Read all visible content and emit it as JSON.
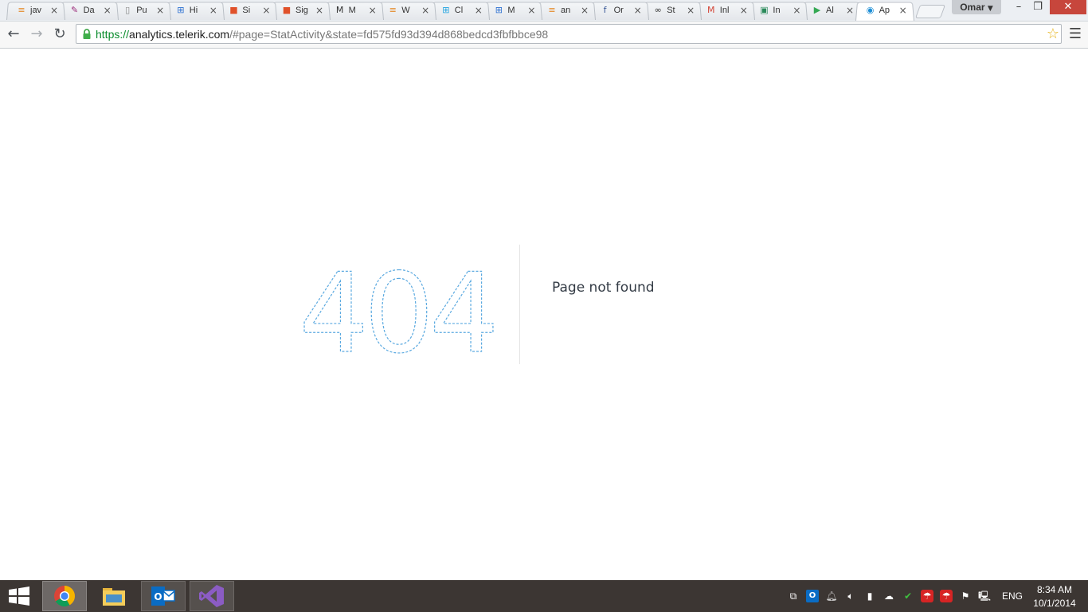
{
  "browser": {
    "tabs": [
      {
        "title": "jav",
        "icon": "stackoverflow-icon",
        "icon_glyph": "≡",
        "icon_color": "#e48a2a",
        "active": false
      },
      {
        "title": "Da",
        "icon": "feather-icon",
        "icon_glyph": "✎",
        "icon_color": "#9b2a7a",
        "active": false
      },
      {
        "title": "Pu",
        "icon": "page-icon",
        "icon_glyph": "▯",
        "icon_color": "#888888",
        "active": false
      },
      {
        "title": "Hi",
        "icon": "windows-icon",
        "icon_glyph": "⊞",
        "icon_color": "#2a6fd1",
        "active": false
      },
      {
        "title": "Si",
        "icon": "microsoft-icon",
        "icon_glyph": "■",
        "icon_color": "#e0512a",
        "active": false
      },
      {
        "title": "Sig",
        "icon": "microsoft-icon",
        "icon_glyph": "■",
        "icon_color": "#e0512a",
        "active": false
      },
      {
        "title": "M",
        "icon": "medium-icon",
        "icon_glyph": "M",
        "icon_color": "#333333",
        "active": false
      },
      {
        "title": "W",
        "icon": "stackoverflow-icon",
        "icon_glyph": "≡",
        "icon_color": "#e48a2a",
        "active": false
      },
      {
        "title": "Cl",
        "icon": "windows-icon",
        "icon_glyph": "⊞",
        "icon_color": "#1fa3e0",
        "active": false
      },
      {
        "title": "M",
        "icon": "windows-flag-icon",
        "icon_glyph": "⊞",
        "icon_color": "#2a6fd1",
        "active": false
      },
      {
        "title": "an",
        "icon": "stackoverflow-icon",
        "icon_glyph": "≡",
        "icon_color": "#e48a2a",
        "active": false
      },
      {
        "title": "Or",
        "icon": "facebook-icon",
        "icon_glyph": "f",
        "icon_color": "#3b5998",
        "active": false
      },
      {
        "title": "St",
        "icon": "link-icon",
        "icon_glyph": "∞",
        "icon_color": "#333333",
        "active": false
      },
      {
        "title": "Inl",
        "icon": "gmail-icon",
        "icon_glyph": "M",
        "icon_color": "#d44638",
        "active": false
      },
      {
        "title": "In",
        "icon": "inbox-icon",
        "icon_glyph": "▣",
        "icon_color": "#2a8a5a",
        "active": false
      },
      {
        "title": "Al",
        "icon": "play-store-icon",
        "icon_glyph": "▶",
        "icon_color": "#34a853",
        "active": false
      },
      {
        "title": "Ap",
        "icon": "telerik-analytics-icon",
        "icon_glyph": "◉",
        "icon_color": "#1c8ed6",
        "active": true
      }
    ],
    "profile_name": "Omar",
    "url": {
      "scheme": "https://",
      "host": "analytics.telerik.com",
      "path": "/#page=StatActivity&state=fd575fd93d394d868bedcd3fbfbbce98"
    }
  },
  "page": {
    "error_code": "404",
    "error_message": "Page not found",
    "accent_color": "#5aa9e0"
  },
  "taskbar": {
    "language": "ENG",
    "time": "8:34 AM",
    "date": "10/1/2014"
  }
}
